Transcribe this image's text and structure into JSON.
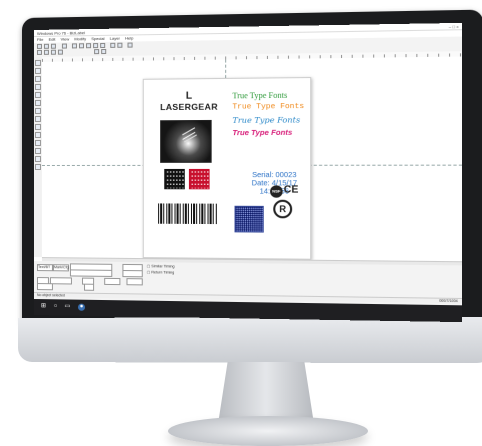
{
  "window": {
    "title": "Windows Pro 76 - BizLabel",
    "controls": "–  □  ×"
  },
  "menu": [
    "File",
    "Edit",
    "View",
    "Modify",
    "Special",
    "Layer",
    "Help"
  ],
  "label": {
    "logo_mark": "L",
    "logo_text": "LASERGEAR",
    "fonts": [
      "True Type Fonts",
      "True Type Fonts",
      "True Type Fonts",
      "True Type Fonts"
    ],
    "serial": "Serial: 00023",
    "date": "Date: 4/15/17",
    "time": "14:23:56",
    "nsf": "NSF",
    "ce": "CE",
    "registered": "R"
  },
  "bottom_panel": {
    "btn1": "Text/BT",
    "btn2": "Mark/Cfg",
    "check1": "Similar Timing",
    "check2": "Return Timing"
  },
  "status": {
    "left": "No object selected",
    "right": "000/7/1004"
  },
  "taskbar": {
    "start_icon": "windows-logo-icon",
    "search_icon": "search-icon",
    "app_icon": "app-icon"
  }
}
